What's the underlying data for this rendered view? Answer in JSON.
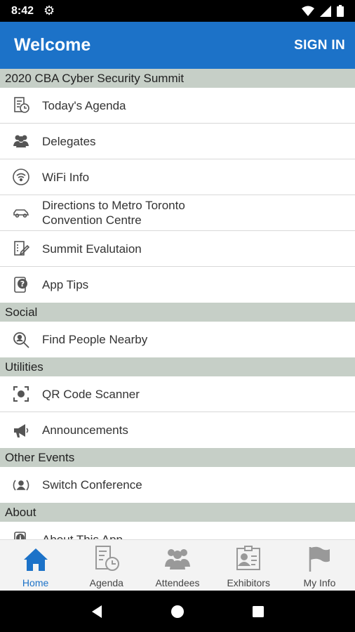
{
  "status": {
    "time": "8:42"
  },
  "appbar": {
    "title": "Welcome",
    "signin": "SIGN IN"
  },
  "sections": [
    {
      "header": "2020 CBA Cyber Security Summit",
      "items": [
        {
          "label": "Today's Agenda",
          "icon": "agenda-clock-icon"
        },
        {
          "label": "Delegates",
          "icon": "people-icon"
        },
        {
          "label": "WiFi Info",
          "icon": "wifi-icon"
        },
        {
          "label": "Directions to Metro Toronto\nConvention Centre",
          "icon": "car-icon"
        },
        {
          "label": "Summit Evalutaion",
          "icon": "evaluation-icon"
        },
        {
          "label": "App Tips",
          "icon": "help-icon"
        }
      ]
    },
    {
      "header": "Social",
      "items": [
        {
          "label": "Find People Nearby",
          "icon": "search-person-icon"
        }
      ]
    },
    {
      "header": "Utilities",
      "items": [
        {
          "label": "QR Code Scanner",
          "icon": "qr-scanner-icon"
        },
        {
          "label": "Announcements",
          "icon": "megaphone-icon"
        }
      ]
    },
    {
      "header": "Other Events",
      "items": [
        {
          "label": "Switch Conference",
          "icon": "switch-icon"
        }
      ]
    },
    {
      "header": "About",
      "items": [
        {
          "label": "About This App",
          "icon": "info-icon"
        }
      ]
    }
  ],
  "tabs": [
    {
      "label": "Home",
      "icon": "home-icon",
      "active": true
    },
    {
      "label": "Agenda",
      "icon": "agenda-icon"
    },
    {
      "label": "Attendees",
      "icon": "attendees-icon"
    },
    {
      "label": "Exhibitors",
      "icon": "exhibitors-icon"
    },
    {
      "label": "My Info",
      "icon": "flag-icon"
    }
  ],
  "colors": {
    "primary": "#1c72c8",
    "section_bg": "#c6cfc7",
    "icon_gray": "#9a9a9a"
  }
}
